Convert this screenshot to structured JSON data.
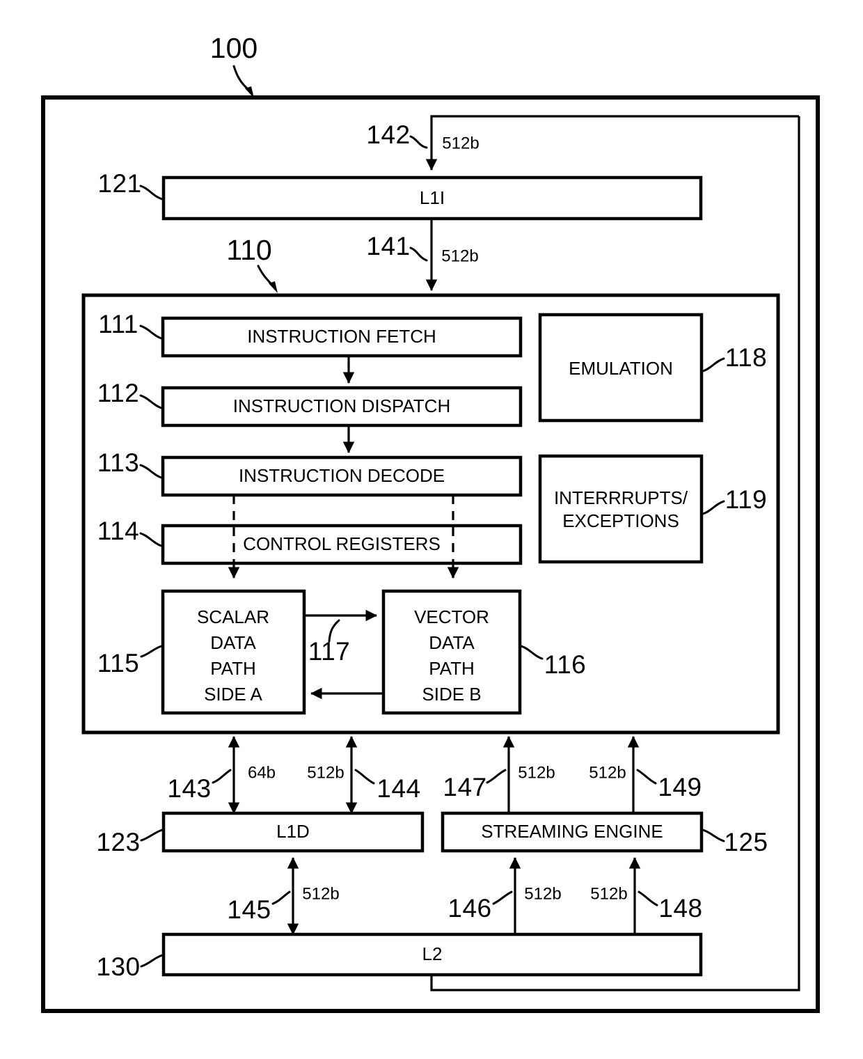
{
  "figure": {
    "top_reference": "100",
    "cpu_reference": "110"
  },
  "blocks": {
    "l1i": {
      "label": "L1I",
      "ref": "121"
    },
    "instruction_fetch": {
      "label": "INSTRUCTION FETCH",
      "ref": "111"
    },
    "instruction_dispatch": {
      "label": "INSTRUCTION DISPATCH",
      "ref": "112"
    },
    "instruction_decode": {
      "label": "INSTRUCTION DECODE",
      "ref": "113"
    },
    "control_registers": {
      "label": "CONTROL REGISTERS",
      "ref": "114"
    },
    "emulation": {
      "label": "EMULATION",
      "ref": "118"
    },
    "interrupts": {
      "label_line1": "INTERRRUPTS/",
      "label_line2": "EXCEPTIONS",
      "ref": "119"
    },
    "scalar_datapath": {
      "label_line1": "SCALAR",
      "label_line2": "DATA",
      "label_line3": "PATH",
      "label_line4": "SIDE A",
      "ref": "115"
    },
    "vector_datapath": {
      "label_line1": "VECTOR",
      "label_line2": "DATA",
      "label_line3": "PATH",
      "label_line4": "SIDE B",
      "ref": "116"
    },
    "datapath_crosslink": {
      "ref": "117"
    },
    "l1d": {
      "label": "L1D",
      "ref": "123"
    },
    "streaming_engine": {
      "label": "STREAMING ENGINE",
      "ref": "125"
    },
    "l2": {
      "label": "L2",
      "ref": "130"
    }
  },
  "buses": [
    {
      "ref": "141",
      "width": "512b"
    },
    {
      "ref": "142",
      "width": "512b"
    },
    {
      "ref": "143",
      "width": "64b"
    },
    {
      "ref": "144",
      "width": "512b"
    },
    {
      "ref": "145",
      "width": "512b"
    },
    {
      "ref": "146",
      "width": "512b"
    },
    {
      "ref": "147",
      "width": "512b"
    },
    {
      "ref": "148",
      "width": "512b"
    },
    {
      "ref": "149",
      "width": "512b"
    }
  ],
  "colors": {
    "stroke": "#000000",
    "background": "#ffffff"
  }
}
